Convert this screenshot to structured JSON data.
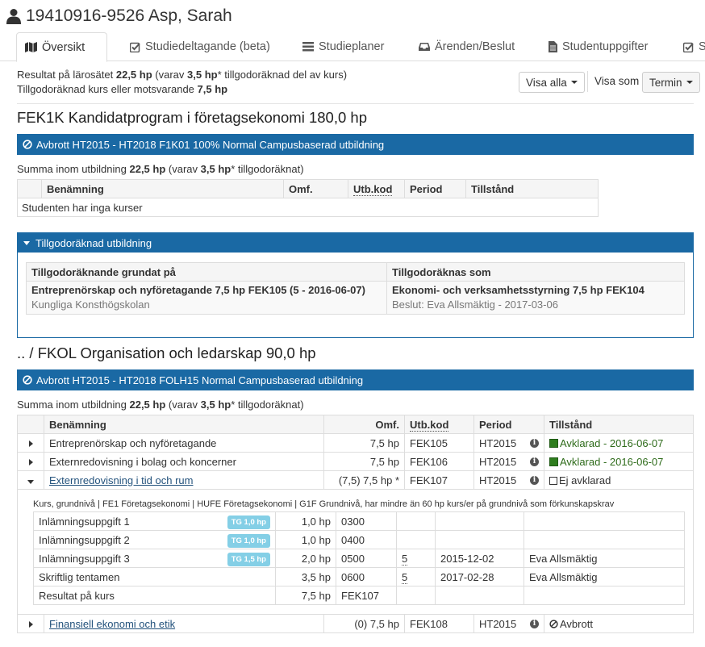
{
  "header": {
    "title": "19410916-9526 Asp, Sarah",
    "icon": "user-icon"
  },
  "tabs": [
    {
      "label": "Översikt",
      "icon": "map-icon",
      "active": true
    },
    {
      "label": "Studiedeltagande (beta)",
      "icon": "checkbox-icon"
    },
    {
      "label": "Studieplaner",
      "icon": "list-icon"
    },
    {
      "label": "Ärenden/Beslut",
      "icon": "inbox-icon"
    },
    {
      "label": "Studentuppgifter",
      "icon": "file-icon"
    },
    {
      "label": "S",
      "icon": "checkbox-icon"
    }
  ],
  "summary": {
    "line1_a": "Resultat på lärosätet",
    "line1_b": "22,5 hp",
    "line1_c": "(varav",
    "line1_d": "3,5 hp",
    "line1_e": "* tillgodoräknad del av kurs)",
    "line2_a": "Tillgodoräknad kurs eller motsvarande",
    "line2_b": "7,5 hp"
  },
  "controls": {
    "show_all": "Visa alla",
    "view_as_label": "Visa som",
    "view_as_value": "Termin"
  },
  "program1": {
    "title": "FEK1K Kandidatprogram i företagsekonomi 180,0 hp",
    "bar": "Avbrott HT2015 - HT2018 F1K01 100% Normal Campusbaserad utbildning",
    "sum_a": "Summa inom utbildning",
    "sum_b": "22,5 hp",
    "sum_c": "(varav",
    "sum_d": "3,5 hp",
    "sum_e": "* tillgodoräknat)",
    "headers": [
      "Benämning",
      "Omf.",
      "Utb.kod",
      "Period",
      "Tillstånd"
    ],
    "empty": "Studenten har inga kurser"
  },
  "credit_panel": {
    "title": "Tillgodoräknad utbildning",
    "col1": "Tillgodoräknande grundat på",
    "col2": "Tillgodoräknas som",
    "basis_course": "Entreprenörskap och nyföretagande 7,5 hp FEK105 (5 - 2016-06-07)",
    "basis_school": "Kungliga Konsthögskolan",
    "as_course": "Ekonomi- och verksamhetsstyrning 7,5 hp FEK104",
    "as_decision": "Beslut: Eva Allsmäktig - 2017-03-06"
  },
  "program2": {
    "title": ".. / FKOL Organisation och ledarskap 90,0 hp",
    "bar": "Avbrott HT2015 - HT2018 FOLH15 Normal Campusbaserad utbildning",
    "sum_a": "Summa inom utbildning",
    "sum_b": "22,5 hp",
    "sum_c": "(varav",
    "sum_d": "3,5 hp",
    "sum_e": "* tillgodoräknat)",
    "headers": [
      "Benämning",
      "Omf.",
      "Utb.kod",
      "Period",
      "Tillstånd"
    ],
    "rows": [
      {
        "name": "Entreprenörskap och nyföretagande",
        "omf": "7,5 hp",
        "code": "FEK105",
        "period": "HT2015",
        "status": "Avklarad - 2016-06-07"
      },
      {
        "name": "Externredovisning i bolag och koncerner",
        "omf": "7,5 hp",
        "code": "FEK106",
        "period": "HT2015",
        "status": "Avklarad - 2016-06-07"
      },
      {
        "name": "Externredovisning i tid och rum",
        "omf": "(7,5) 7,5 hp *",
        "code": "FEK107",
        "period": "HT2015",
        "status": "Ej avklarad"
      },
      {
        "name": "Finansiell ekonomi och etik",
        "omf": "(0) 7,5 hp",
        "code": "FEK108",
        "period": "HT2015",
        "status": "Avbrott"
      }
    ],
    "course_meta": "Kurs, grundnivå | FE1 Företagsekonomi | HUFE Företagsekonomi | G1F Grundnivå, har mindre än 60 hp kurs/er på grundnivå som förkunskapskrav",
    "modules": [
      {
        "name": "Inlämningsuppgift 1",
        "tg": "TG 1,0 hp",
        "omf": "1,0 hp",
        "code": "0300",
        "grade": "",
        "date": "",
        "examiner": ""
      },
      {
        "name": "Inlämningsuppgift 2",
        "tg": "TG 1,0 hp",
        "omf": "1,0 hp",
        "code": "0400",
        "grade": "",
        "date": "",
        "examiner": ""
      },
      {
        "name": "Inlämningsuppgift 3",
        "tg": "TG 1,5 hp",
        "omf": "2,0 hp",
        "code": "0500",
        "grade": "5",
        "date": "2015-12-02",
        "examiner": "Eva Allsmäktig"
      },
      {
        "name": "Skriftlig tentamen",
        "tg": "",
        "omf": "3,5 hp",
        "code": "0600",
        "grade": "5",
        "date": "2017-02-28",
        "examiner": "Eva Allsmäktig"
      },
      {
        "name": "Resultat på kurs",
        "tg": "",
        "omf": "7,5 hp",
        "code": "FEK107",
        "grade": "",
        "date": "",
        "examiner": ""
      }
    ]
  },
  "colors": {
    "brand": "#1a69a4",
    "success": "#2e7d1e",
    "badge": "#5bc0de",
    "link": "#23527c"
  }
}
